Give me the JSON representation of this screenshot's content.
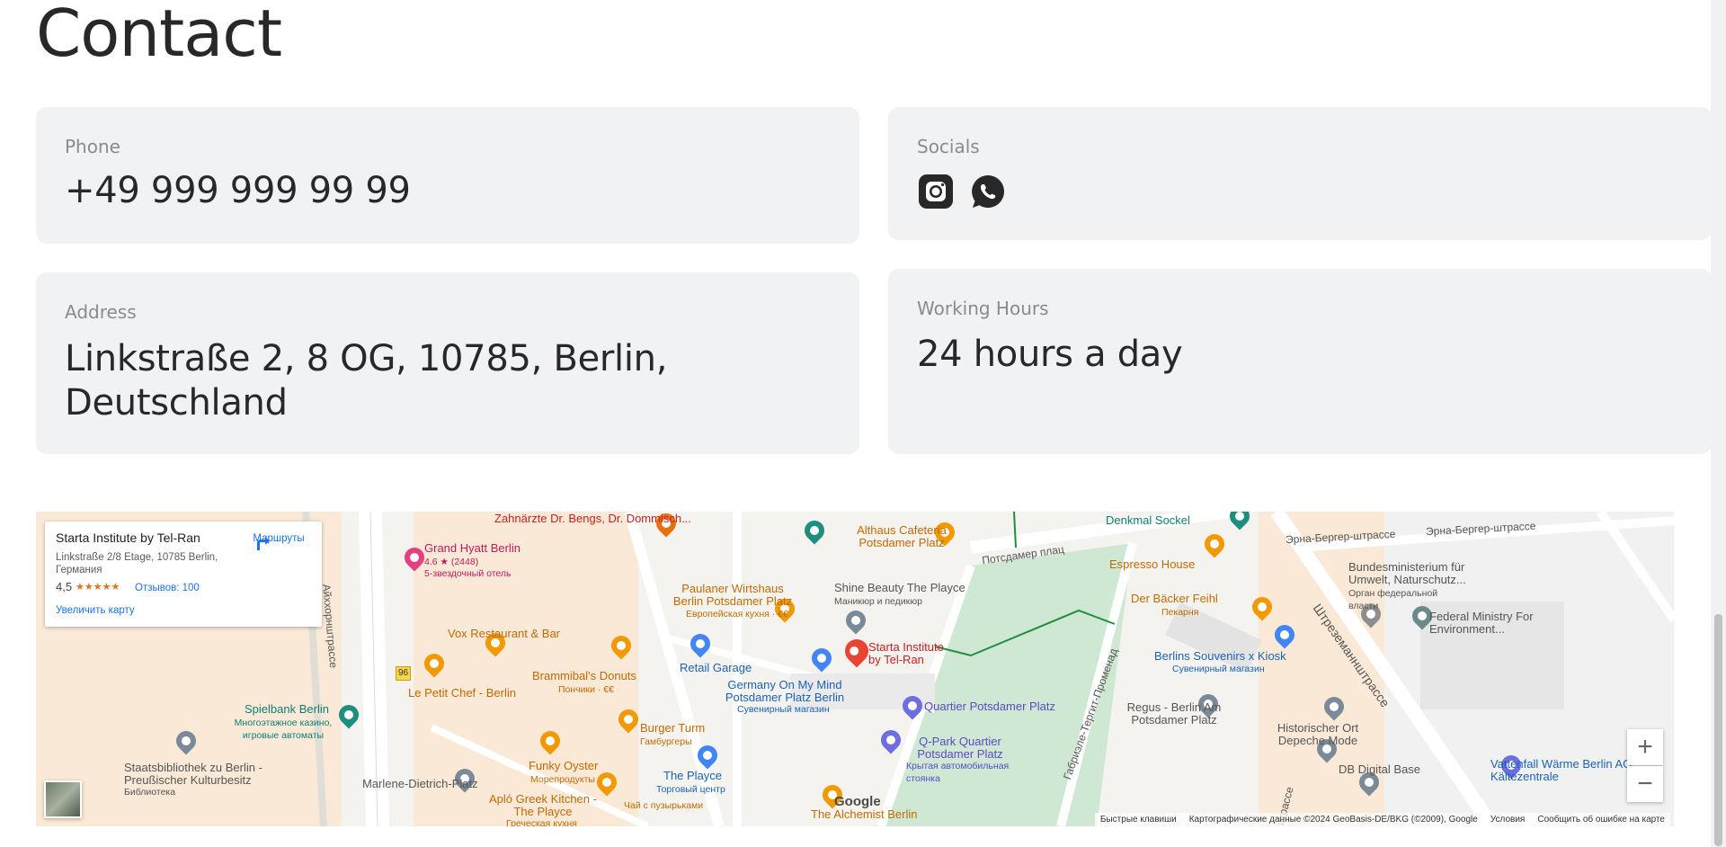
{
  "page": {
    "title": "Contact"
  },
  "cards": {
    "phone": {
      "label": "Phone",
      "value": "+49 999 999 99 99"
    },
    "socials": {
      "label": "Socials",
      "icons": [
        "instagram-icon",
        "whatsapp-icon"
      ]
    },
    "address": {
      "label": "Address",
      "line1": "Linkstraße 2, 8 OG, 10785, Berlin,",
      "line2": "Deutschland"
    },
    "hours": {
      "label": "Working Hours",
      "value": "24 hours a day"
    }
  },
  "map": {
    "infobox": {
      "title": "Starta Institute by Tel-Ran",
      "address": "Linkstraße 2/8 Etage, 10785 Berlin, Германия",
      "rating": "4,5",
      "stars": "★★★★★",
      "reviews": "Отзывов: 100",
      "directions": "Маршруты",
      "enlarge": "Увеличить карту"
    },
    "labels": {
      "dentists": "Zahnärzte Dr. Bengs, Dr. Dommisch...",
      "grand_hyatt": "Grand Hyatt Berlin",
      "grand_hyatt_rating": "4.6 ★ (2448)",
      "grand_hyatt_sub": "5-звездочный отель",
      "althaus": "Althaus Cafeteria Potsdamer Platz",
      "potsdamer_platz_street": "Потсдамер плац",
      "denkmal": "Denkmal Sockel",
      "espresso": "Espresso House",
      "erna1": "Эрна-Бергер-штрассе",
      "erna2": "Эрна-Бергер-штрассе",
      "ministry_de": "Bundesministerium für Umwelt, Naturschutz...",
      "ministry_sub": "Орган федеральной власти",
      "federal_ministry": "Federal Ministry For Environment...",
      "eichhorn": "Айххорнштрассе",
      "paulaner": "Paulaner Wirtshaus Berlin Potsdamer Platz",
      "paulaner_sub": "Европейская кухня · €€",
      "shine": "Shine Beauty The Playce",
      "shine_sub": "Маникюр и педикюр",
      "baecker": "Der Bäcker Feihl",
      "baecker_sub": "Пекарня",
      "vox": "Vox Restaurant & Bar",
      "starta": "Starta Institute by Tel-Ran",
      "berlins_souvenirs": "Berlins Souvenirs x Kiosk",
      "berlins_souvenirs_sub": "Сувенирный магазин",
      "stresemann": "Штреземаннштрассе",
      "road96": "96",
      "brammibal": "Brammibal's Donuts",
      "brammibal_sub": "Пончики · €€",
      "retail": "Retail Garage",
      "le_petit": "Le Petit Chef - Berlin",
      "germany_mind": "Germany On My Mind Potsdamer Platz Berlin",
      "germany_mind_sub": "Сувенирный магазин",
      "quartier": "Quartier Potsdamer Platz",
      "gabriele": "Габриэле-Тергит-Променад",
      "regus": "Regus - Berlin Am Potsdamer Platz",
      "spielbank": "Spielbank Berlin",
      "spielbank_sub": "Многоэтажное казино, игровые автоматы",
      "burger": "Burger Turm",
      "burger_sub": "Гамбургеры",
      "qpark": "Q-Park Quartier Potsdamer Platz",
      "qpark_sub": "Крытая автомобильная стоянка",
      "historischer": "Historischer Ort Depeche Mode",
      "staatsbib": "Staatsbibliothek zu Berlin - Preußischer Kulturbesitz",
      "staatsbib_sub": "Библиотека",
      "funky": "Funky Oyster",
      "funky_sub": "Морепродукты",
      "playce": "The Playce",
      "playce_sub": "Торговый центр",
      "db_digital": "DB Digital Base",
      "vattenfall": "Vattenfall Wärme Berlin AG, Kältezentrale",
      "marlene": "Marlene-Dietrich-Platz",
      "aplo": "Apló Greek Kitchen - The Playce",
      "aplo_sub": "Греческая кухня",
      "chai": "Чай с пузырьками",
      "alchemist": "The Alchemist Berlin",
      "google": "Google",
      "strasse_fragment": "штрассе"
    },
    "zoom_in": "+",
    "zoom_out": "−",
    "attribution": {
      "shortcuts": "Быстрые клавиши",
      "data": "Картографические данные ©2024 GeoBasis-DE/BKG (©2009), Google",
      "terms": "Условия",
      "report": "Сообщить об ошибке на карте"
    }
  },
  "colors": {
    "card_bg": "#f1f2f4",
    "label": "#8b8b8b",
    "text": "#282828",
    "map_park": "#c8e6c9",
    "map_orange": "#f29900",
    "map_blue": "#4285f4",
    "map_red": "#ea4335"
  }
}
